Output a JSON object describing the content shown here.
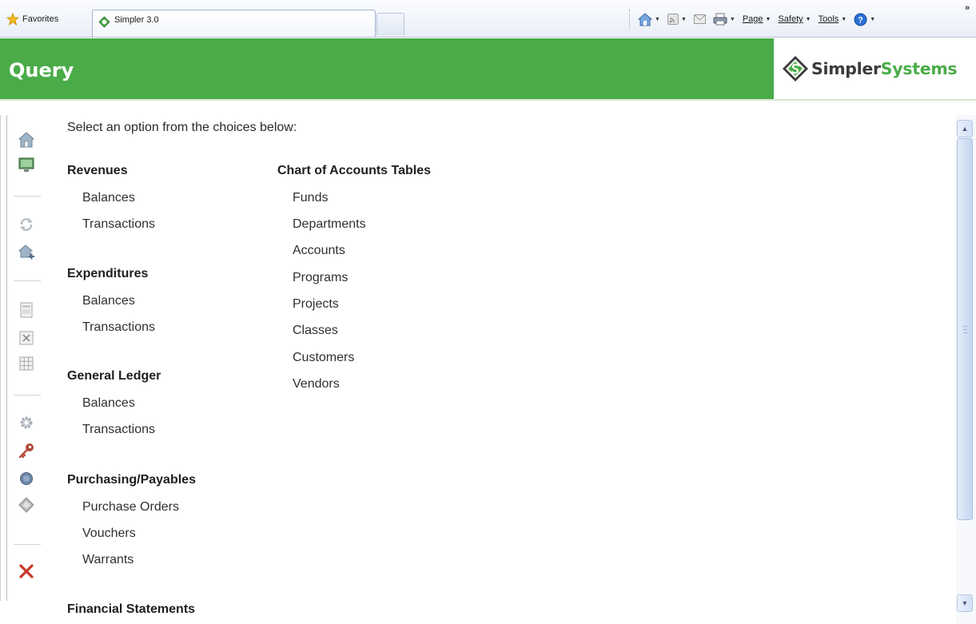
{
  "browser": {
    "favorites_label": "Favorites",
    "tab_title": "Simpler 3.0",
    "commands": {
      "page": "Page",
      "safety": "Safety",
      "tools": "Tools"
    },
    "more_glyph": "»"
  },
  "header": {
    "title": "Query",
    "logo_part1": "Simpler",
    "logo_part2": "Systems",
    "colors": {
      "green": "#4aac48",
      "logo_dark": "#3b3b3b"
    }
  },
  "sidebar_icons": [
    "home-icon",
    "monitor-icon",
    "refresh-icon",
    "home-add-icon",
    "document-icon",
    "excel-icon",
    "grid-icon",
    "settings-icon",
    "key-icon",
    "info-icon",
    "logo-icon",
    "close-icon"
  ],
  "main": {
    "intro": "Select an option from the choices below:",
    "left_column": [
      {
        "heading": "Revenues",
        "links": [
          "Balances",
          "Transactions"
        ]
      },
      {
        "heading": "Expenditures",
        "links": [
          "Balances",
          "Transactions"
        ]
      },
      {
        "heading": "General Ledger",
        "links": [
          "Balances",
          "Transactions"
        ]
      },
      {
        "heading": "Purchasing/Payables",
        "links": [
          "Purchase Orders",
          "Vouchers",
          "Warrants"
        ]
      },
      {
        "heading": "Financial Statements",
        "links": []
      }
    ],
    "right_column": {
      "heading": "Chart of Accounts Tables",
      "links": [
        "Funds",
        "Departments",
        "Accounts",
        "Programs",
        "Projects",
        "Classes",
        "Customers",
        "Vendors"
      ]
    }
  }
}
